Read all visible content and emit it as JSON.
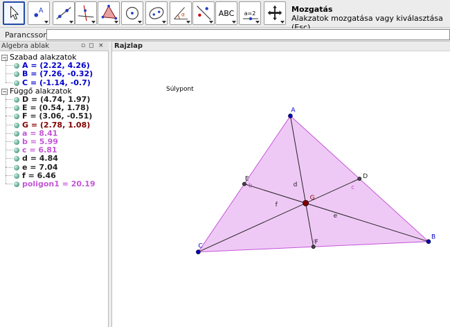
{
  "toolbar": {
    "tools": [
      {
        "icon": "move-arrow-icon",
        "selected": true
      },
      {
        "icon": "new-point-icon"
      },
      {
        "icon": "line-through-two-points-icon"
      },
      {
        "icon": "perpendicular-line-icon"
      },
      {
        "icon": "polygon-icon"
      },
      {
        "icon": "circle-with-center-icon"
      },
      {
        "icon": "ellipse-icon"
      },
      {
        "icon": "angle-icon"
      },
      {
        "icon": "reflect-about-line-icon"
      },
      {
        "icon": "text-icon",
        "text": "ABC"
      },
      {
        "icon": "slider-icon",
        "text": "a=2"
      },
      {
        "icon": "move-graphics-view-icon"
      }
    ],
    "active_tool_name": "Mozgatás",
    "active_tool_help": "Alakzatok mozgatása vagy kiválasztása (Esc)"
  },
  "command_bar": {
    "label": "Parancssor:",
    "value": ""
  },
  "algebra": {
    "title": "Algebra ablak",
    "header_buttons": [
      "▫",
      "◻",
      "×"
    ],
    "free_group": "Szabad alakzatok",
    "dependent_group": "Függő alakzatok",
    "free": [
      {
        "text": "A = (2.22, 4.26)",
        "color": "blue"
      },
      {
        "text": "B = (7.26, -0.32)",
        "color": "blue"
      },
      {
        "text": "C = (-1.14, -0.7)",
        "color": "blue"
      }
    ],
    "dependent": [
      {
        "text": "D = (4.74, 1.97)",
        "color": "dark"
      },
      {
        "text": "E = (0.54, 1.78)",
        "color": "dark"
      },
      {
        "text": "F = (3.06, -0.51)",
        "color": "dark"
      },
      {
        "text": "G = (2.78, 1.08)",
        "color": "maroon"
      },
      {
        "text": "a = 8.41",
        "color": "pink"
      },
      {
        "text": "b = 5.99",
        "color": "pink"
      },
      {
        "text": "c = 6.81",
        "color": "pink"
      },
      {
        "text": "d = 4.84",
        "color": "dark"
      },
      {
        "text": "e = 7.04",
        "color": "dark"
      },
      {
        "text": "f = 6.46",
        "color": "dark"
      },
      {
        "text": "poligon1 = 20.19",
        "color": "pink"
      }
    ]
  },
  "graphics": {
    "title": "Rajzlap",
    "caption": "Súlypont",
    "points": [
      {
        "name": "A",
        "x": 2.22,
        "y": 4.26
      },
      {
        "name": "B",
        "x": 7.26,
        "y": -0.32
      },
      {
        "name": "C",
        "x": -1.14,
        "y": -0.7
      },
      {
        "name": "D",
        "x": 4.74,
        "y": 1.97
      },
      {
        "name": "E",
        "x": 0.54,
        "y": 1.78
      },
      {
        "name": "F",
        "x": 3.06,
        "y": -0.51
      },
      {
        "name": "G",
        "x": 2.78,
        "y": 1.08
      }
    ],
    "side_labels": [
      "a",
      "b",
      "c"
    ],
    "median_labels": [
      "d",
      "e",
      "f"
    ],
    "colors": {
      "polygon_fill": "#efc9f5",
      "polygon_stroke": "#c455d8",
      "free_point": "#0000cc",
      "dependent_point": "#444444",
      "centroid": "#800000"
    }
  }
}
